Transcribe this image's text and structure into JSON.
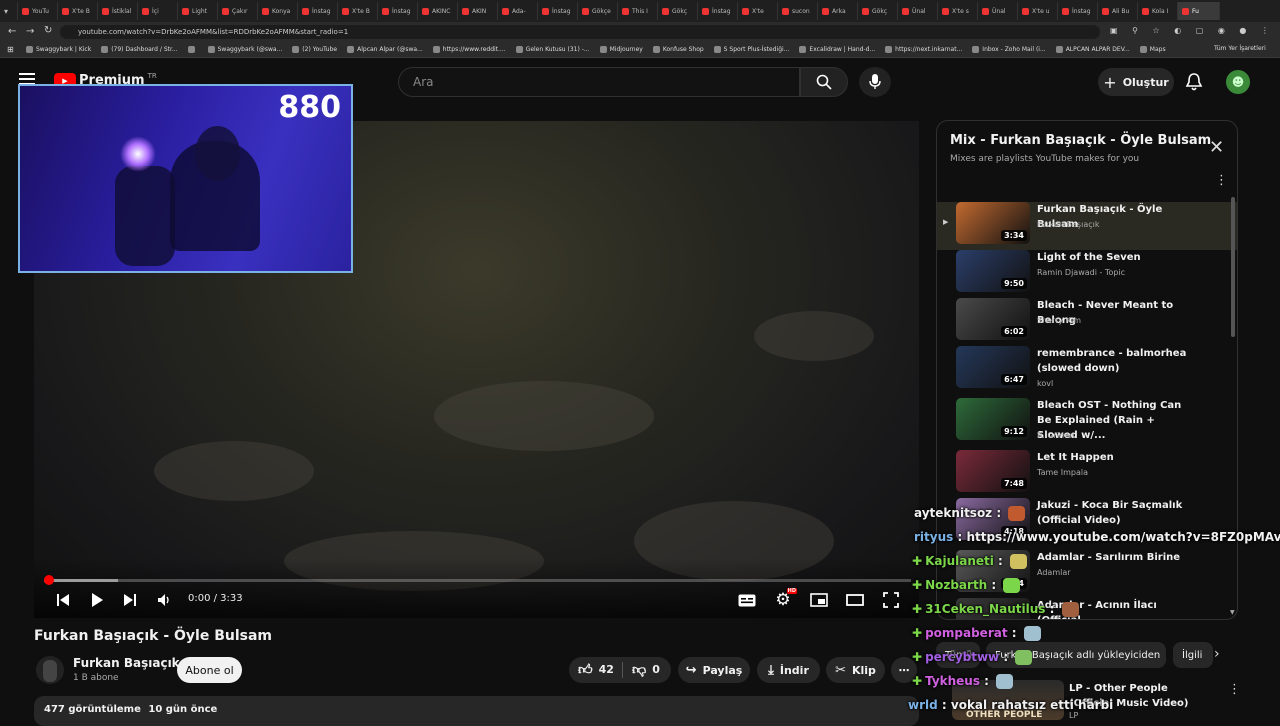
{
  "browser": {
    "tabs": [
      "YouTu",
      "X'te B",
      "İstiklal",
      "İçi",
      "Light",
      "Çakır",
      "Konya",
      "İnstag",
      "X'te B",
      "İnstag",
      "AKINC",
      "AKIN",
      "Ada-",
      "İnstag",
      "Gökçe",
      "This I",
      "Gökç",
      "İnstag",
      "X'te",
      "sucon",
      "Arka",
      "Gökç",
      "Ünal",
      "X'te s",
      "Ünal",
      "X'te u",
      "İnstag",
      "Ali Bu",
      "Kola I",
      "Fu"
    ],
    "url": "youtube.com/watch?v=DrbKe2oAFMM&list=RDDrbKe2oAFMM&start_radio=1",
    "bookmarks": [
      "Swaggybark | Kick",
      "(79) Dashboard / Str...",
      "",
      "Swaggybark (@swa...",
      "(2) YouTube",
      "Alpcan Alpar (@swa...",
      "https://www.reddit....",
      "Gelen Kutusu (31) -...",
      "Midjourney",
      "Konfuse Shop",
      "S Sport Plus-İstediği...",
      "Excalidraw | Hand-d...",
      "https://next.inkarnat...",
      "Inbox - Zoho Mail (i...",
      "ALPCAN ALPAR DEV...",
      "Maps"
    ],
    "bookmarks_right": "Tüm Yer İşaretleri"
  },
  "header": {
    "logo": "Premium",
    "country": "TR",
    "search_placeholder": "Ara",
    "create_label": "Oluştur"
  },
  "webcam": {
    "count": "880"
  },
  "player": {
    "time": "0:00 / 3:33",
    "progress": 0,
    "buffered": 0.085,
    "hd_badge": "HD"
  },
  "video": {
    "title": "Furkan Başıaçık - Öyle Bulsam",
    "channel": "Furkan Başıaçık",
    "subscribers": "1 B abone",
    "subscribe_label": "Abone ol",
    "likes": "42",
    "dislikes": "0",
    "share_label": "Paylaş",
    "download_label": "İndir",
    "clip_label": "Klip",
    "views": "477 görüntüleme",
    "date": "10 gün önce"
  },
  "playlist": {
    "title": "Mix - Furkan Başıaçık - Öyle Bulsam",
    "subtitle": "Mixes are playlists YouTube makes for you",
    "items": [
      {
        "title": "Furkan Başıaçık - Öyle Bulsam",
        "artist": "Furkan Başıaçık",
        "duration": "3:34",
        "color": "#c26a30"
      },
      {
        "title": "Light of the Seven",
        "artist": "Ramin Djawadi - Topic",
        "duration": "9:50",
        "color": "#2b3f6a"
      },
      {
        "title": "Bleach - Never Meant to Belong",
        "artist": "Sherry Kim",
        "duration": "6:02",
        "color": "#4a4a4a"
      },
      {
        "title": "remembrance - balmorhea (slowed down)",
        "artist": "kovl",
        "duration": "6:47",
        "color": "#24385a"
      },
      {
        "title": "Bleach OST - Nothing Can Be Explained (Rain + Slowed w/...",
        "artist": "R. Grimm",
        "duration": "9:12",
        "color": "#2e6b3a"
      },
      {
        "title": "Let It Happen",
        "artist": "Tame Impala",
        "duration": "7:48",
        "color": "#7a2a3a"
      },
      {
        "title": "Jakuzi - Koca Bir Saçmalık (Official Video)",
        "artist": "",
        "duration": "4:18",
        "color": "#8a6aa0"
      },
      {
        "title": "Adamlar - Sarılırım Birine",
        "artist": "Adamlar",
        "duration": "4:24",
        "color": "#5a5a5a"
      },
      {
        "title": "Adamlar - Acının İlacı (Official",
        "artist": "",
        "duration": "",
        "color": "#3a3a3a"
      }
    ]
  },
  "chips": [
    "Tümü",
    "Furkan Başıaçık adlı yükleyiciden",
    "İlgili"
  ],
  "next_video": {
    "title": "LP - Other People (Official Music Video)",
    "badge": "OTHER PEOPLE",
    "artist": "LP"
  },
  "chat": [
    {
      "user": "ayteknitsoz",
      "msg": "",
      "color": "#f1f1f1",
      "badge": false,
      "emote": "#c25a30"
    },
    {
      "user": "rityus",
      "msg": "https://www.youtube.com/watch?v=8FZ0pMAvQFQ",
      "color": "#7ab2e6",
      "badge": false,
      "emote": ""
    },
    {
      "user": "Kajulaneti",
      "msg": "",
      "color": "#7cd64a",
      "badge": true,
      "emote": "#d0c060"
    },
    {
      "user": "Nozbarth",
      "msg": "",
      "color": "#7cd64a",
      "badge": true,
      "emote": "#7cd64a"
    },
    {
      "user": "31Ceken_Nautilus",
      "msg": "",
      "color": "#7cd64a",
      "badge": true,
      "emote": "#a06040"
    },
    {
      "user": "pompaberat",
      "msg": "",
      "color": "#d060e0",
      "badge": true,
      "emote": "#a0c0d0"
    },
    {
      "user": "percybtww",
      "msg": "",
      "color": "#a060e0",
      "badge": true,
      "emote": "#80c060"
    },
    {
      "user": "Tykheus",
      "msg": "",
      "color": "#d060e0",
      "badge": true,
      "emote": "#a0c0d0"
    },
    {
      "user": "wrld",
      "msg": "vokal rahatsız etti harbi",
      "color": "#7ab2e6",
      "badge": false,
      "emote": ""
    }
  ]
}
